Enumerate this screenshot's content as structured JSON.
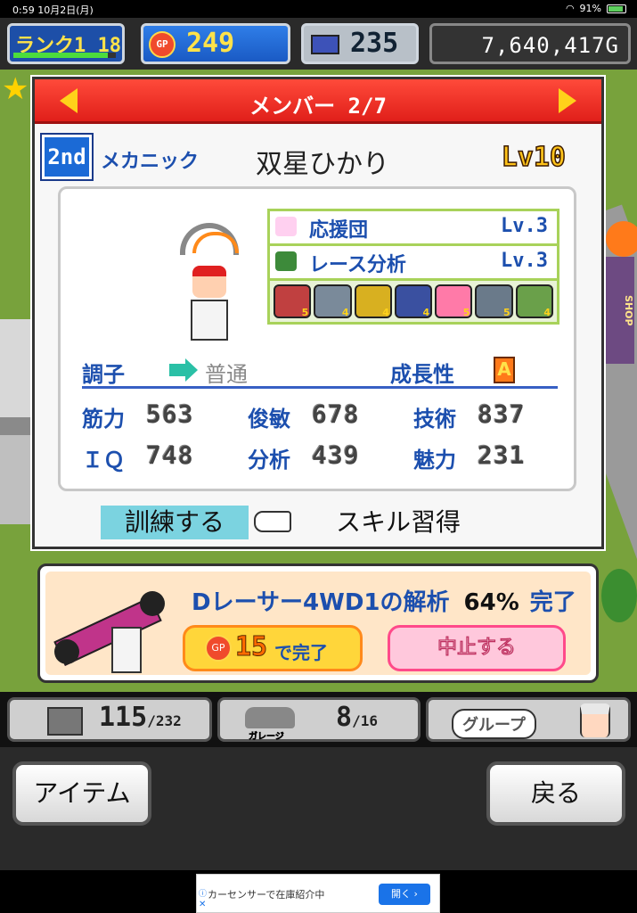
{
  "status_bar": {
    "time": "0:59",
    "date": "10月2日(月)",
    "battery": "91%",
    "icons": [
      "wifi-icon",
      "battery-charging-icon"
    ]
  },
  "hud": {
    "rank_label": "ランク1 18",
    "rank_progress": 0.92,
    "gp": "249",
    "gp_coin": "GP",
    "pc_points": "235",
    "money": "7,640,417G"
  },
  "world": {
    "shop_sign": "SHOP"
  },
  "member_panel": {
    "title": "メンバー 2/7",
    "rank_badge": "2nd",
    "role": "メカニック",
    "name": "双星ひかり",
    "level": "Lv10",
    "skills": [
      {
        "name": "応援団",
        "level": "Lv.3",
        "icon": "pompom-icon"
      },
      {
        "name": "レース分析",
        "level": "Lv.3",
        "icon": "monitor-icon"
      }
    ],
    "parts": [
      {
        "icon": "engine-icon",
        "count": "5"
      },
      {
        "icon": "body-icon",
        "count": "4"
      },
      {
        "icon": "tire-icon",
        "count": "4"
      },
      {
        "icon": "seat-icon",
        "count": "4"
      },
      {
        "icon": "pink-car-icon",
        "count": "5"
      },
      {
        "icon": "wing-icon",
        "count": "5"
      },
      {
        "icon": "road-icon",
        "count": "4"
      }
    ],
    "condition_label": "調子",
    "condition_value": "普通",
    "growth_label": "成長性",
    "growth_grade": "A",
    "stats": [
      {
        "label": "筋力",
        "value": "563"
      },
      {
        "label": "俊敏",
        "value": "678"
      },
      {
        "label": "技術",
        "value": "837"
      },
      {
        "label": "ＩＱ",
        "value": "748"
      },
      {
        "label": "分析",
        "value": "439"
      },
      {
        "label": "魅力",
        "value": "231"
      }
    ],
    "train_button": "訓練する",
    "skill_button": "スキル習得"
  },
  "analysis": {
    "title": "Dレーサー4WD1の解析",
    "percent": "64%",
    "status": "完了",
    "complete_cost": "15",
    "complete_coin": "GP",
    "complete_label": "で完了",
    "cancel_label": "中止する"
  },
  "counters": {
    "parts_current": "115",
    "parts_max": "/232",
    "garage_label": "ガレージ",
    "garage_current": "8",
    "garage_max": "/16",
    "group_label": "グループ"
  },
  "nav": {
    "item_button": "アイテム",
    "back_button": "戻る"
  },
  "ad": {
    "text": "カーセンサーで在庫紹介中",
    "button": "開く ›",
    "info": "ⓘ",
    "close": "✕"
  },
  "colors": {
    "accent_blue": "#1c4fae",
    "header_red": "#e01f1a",
    "gold": "#ffd21a",
    "train_highlight": "#7bd3e0"
  }
}
